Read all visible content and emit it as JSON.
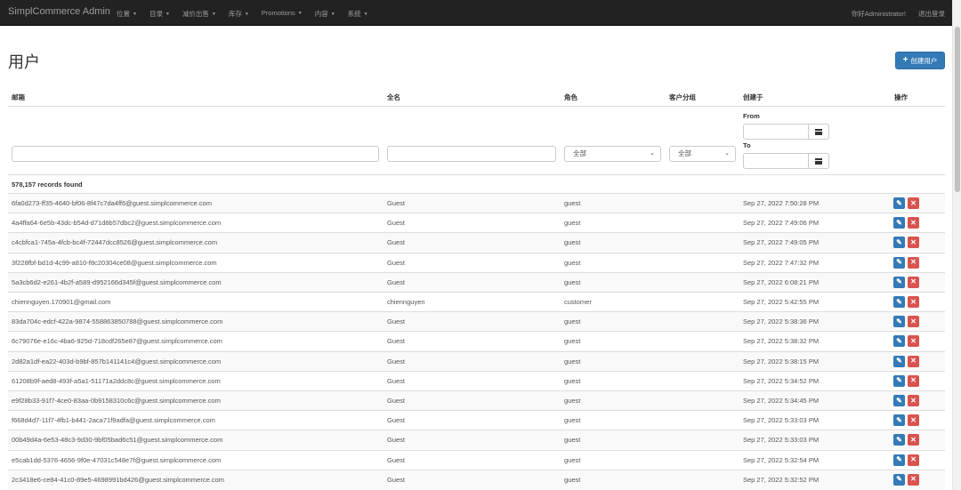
{
  "navbar": {
    "brand": "SimplCommerce Admin",
    "menu": [
      "位置",
      "目录",
      "减价出售",
      "库存",
      "Promotions",
      "内容",
      "系统"
    ],
    "greeting": "你好Administrator!",
    "logout": "退出登录"
  },
  "page": {
    "title": "用户",
    "create_button": "创建用户"
  },
  "table": {
    "headers": {
      "email": "邮箱",
      "fullname": "全名",
      "role": "角色",
      "customer_group": "客户分组",
      "created_on": "创建于",
      "actions": "操作"
    },
    "filters": {
      "role_select": "全部",
      "group_select": "全部",
      "from_label": "From",
      "to_label": "To"
    },
    "records_found": "578,157 records found",
    "rows": [
      {
        "email": "6fa0d273-ff35-4640-bf06-8f47c7da4ff6@guest.simplcommerce.com",
        "name": "Guest",
        "role": "guest",
        "created": "Sep 27, 2022 7:50:28 PM"
      },
      {
        "email": "4a4ffa64-6e5b-43dc-b54d-d71d8b57dbc2@guest.simplcommerce.com",
        "name": "Guest",
        "role": "guest",
        "created": "Sep 27, 2022 7:49:06 PM"
      },
      {
        "email": "c4cbfca1-745a-4fcb-bc4f-72447dcc8526@guest.simplcommerce.com",
        "name": "Guest",
        "role": "guest",
        "created": "Sep 27, 2022 7:49:05 PM"
      },
      {
        "email": "3f228fbf-bd1d-4c99-a810-f8c20304ce08@guest.simplcommerce.com",
        "name": "Guest",
        "role": "guest",
        "created": "Sep 27, 2022 7:47:32 PM"
      },
      {
        "email": "5a3cb6d2-e261-4b2f-a589-d952166d345f@guest.simplcommerce.com",
        "name": "Guest",
        "role": "guest",
        "created": "Sep 27, 2022 6:08:21 PM"
      },
      {
        "email": "chiennguyen.170901@gmail.com",
        "name": "chiennguyen",
        "role": "customer",
        "created": "Sep 27, 2022 5:42:55 PM"
      },
      {
        "email": "83da704c-edcf-422a-9874-558863850788@guest.simplcommerce.com",
        "name": "Guest",
        "role": "guest",
        "created": "Sep 27, 2022 5:38:36 PM"
      },
      {
        "email": "6c79076e-e16c-4ba6-925d-718cdf265e87@guest.simplcommerce.com",
        "name": "Guest",
        "role": "guest",
        "created": "Sep 27, 2022 5:38:32 PM"
      },
      {
        "email": "2d82a1df-ea22-403d-b9bf-857b141141c4@guest.simplcommerce.com",
        "name": "Guest",
        "role": "guest",
        "created": "Sep 27, 2022 5:38:15 PM"
      },
      {
        "email": "61208b9f-aed8-493f-a5a1-51171a2ddc8c@guest.simplcommerce.com",
        "name": "Guest",
        "role": "guest",
        "created": "Sep 27, 2022 5:34:52 PM"
      },
      {
        "email": "e9f28b33-91f7-4ce0-83aa-0b9158310c6c@guest.simplcommerce.com",
        "name": "Guest",
        "role": "guest",
        "created": "Sep 27, 2022 5:34:45 PM"
      },
      {
        "email": "f668d4d7-11f7-4fb1-b441-2aca71f9adfa@guest.simplcommerce.com",
        "name": "Guest",
        "role": "guest",
        "created": "Sep 27, 2022 5:33:03 PM"
      },
      {
        "email": "00b49d4a-6e53-48c3-9d30-9bf05bad6c51@guest.simplcommerce.com",
        "name": "Guest",
        "role": "guest",
        "created": "Sep 27, 2022 5:33:03 PM"
      },
      {
        "email": "e5cab1dd-5376-4656-9f0e-47031c548e7f@guest.simplcommerce.com",
        "name": "Guest",
        "role": "guest",
        "created": "Sep 27, 2022 5:32:54 PM"
      },
      {
        "email": "2c3418e6-ce84-41c0-89e5-4698991bd426@guest.simplcommerce.com",
        "name": "Guest",
        "role": "guest",
        "created": "Sep 27, 2022 5:32:52 PM"
      }
    ]
  }
}
